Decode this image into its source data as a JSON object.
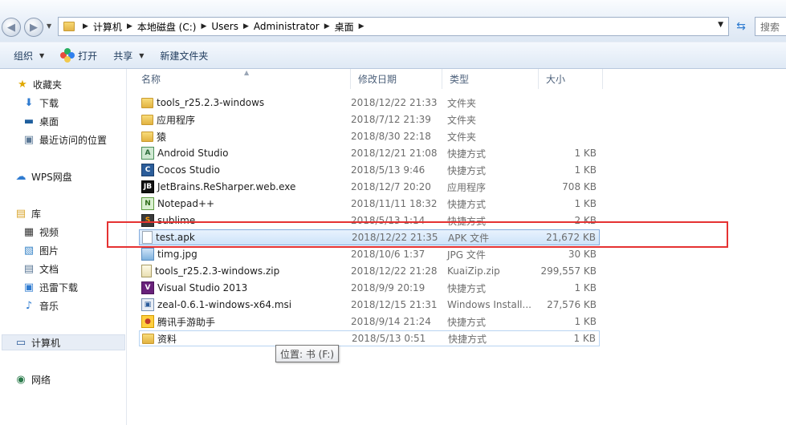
{
  "address_bar": {
    "path": [
      "计算机",
      "本地磁盘 (C:)",
      "Users",
      "Administrator",
      "桌面"
    ]
  },
  "search": {
    "value": "搜索"
  },
  "commands": {
    "organize": "组织",
    "open": "打开",
    "share": "共享",
    "new_folder": "新建文件夹"
  },
  "nav": {
    "favorites": "收藏夹",
    "downloads": "下载",
    "desktop": "桌面",
    "recent": "最近访问的位置",
    "wps": "WPS网盘",
    "libraries": "库",
    "videos": "视频",
    "pictures": "图片",
    "documents": "文档",
    "xunlei": "迅雷下载",
    "music": "音乐",
    "computer": "计算机",
    "network": "网络"
  },
  "columns": {
    "name": "名称",
    "date": "修改日期",
    "type": "类型",
    "size": "大小"
  },
  "files": [
    {
      "name": "tools_r25.2.3-windows",
      "date": "2018/12/22 21:33",
      "type": "文件夹",
      "size": "",
      "icon": "folder-icon"
    },
    {
      "name": "应用程序",
      "date": "2018/7/12 21:39",
      "type": "文件夹",
      "size": "",
      "icon": "folder-icon"
    },
    {
      "name": "猿",
      "date": "2018/8/30 22:18",
      "type": "文件夹",
      "size": "",
      "icon": "folder-icon"
    },
    {
      "name": "Android Studio",
      "date": "2018/12/21 21:08",
      "type": "快捷方式",
      "size": "1 KB",
      "icon": "android-studio-icon"
    },
    {
      "name": "Cocos Studio",
      "date": "2018/5/13 9:46",
      "type": "快捷方式",
      "size": "1 KB",
      "icon": "cocos-studio-icon"
    },
    {
      "name": "JetBrains.ReSharper.web.exe",
      "date": "2018/12/7 20:20",
      "type": "应用程序",
      "size": "708 KB",
      "icon": "jetbrains-icon"
    },
    {
      "name": "Notepad++",
      "date": "2018/11/11 18:32",
      "type": "快捷方式",
      "size": "1 KB",
      "icon": "notepad-plus-plus-icon"
    },
    {
      "name": "sublime",
      "date": "2018/5/13 1:14",
      "type": "快捷方式",
      "size": "2 KB",
      "icon": "sublime-icon"
    },
    {
      "name": "test.apk",
      "date": "2018/12/22 21:35",
      "type": "APK 文件",
      "size": "21,672 KB",
      "icon": "file-icon"
    },
    {
      "name": "timg.jpg",
      "date": "2018/10/6 1:37",
      "type": "JPG 文件",
      "size": "30 KB",
      "icon": "image-file-icon"
    },
    {
      "name": "tools_r25.2.3-windows.zip",
      "date": "2018/12/22 21:28",
      "type": "KuaiZip.zip",
      "size": "299,557 KB",
      "icon": "zip-file-icon"
    },
    {
      "name": "Visual Studio 2013",
      "date": "2018/9/9 20:19",
      "type": "快捷方式",
      "size": "1 KB",
      "icon": "visual-studio-icon"
    },
    {
      "name": "zeal-0.6.1-windows-x64.msi",
      "date": "2018/12/15 21:31",
      "type": "Windows Install...",
      "size": "27,576 KB",
      "icon": "msi-installer-icon"
    },
    {
      "name": "腾讯手游助手",
      "date": "2018/9/14 21:24",
      "type": "快捷方式",
      "size": "1 KB",
      "icon": "tencent-game-assistant-icon"
    },
    {
      "name": "资料",
      "date": "2018/5/13 0:51",
      "type": "快捷方式",
      "size": "1 KB",
      "icon": "folder-shortcut-icon"
    }
  ],
  "tooltip": "位置: 书 (F:)",
  "colors": {
    "highlight": "#e53232",
    "selection_border": "#84acdd"
  }
}
